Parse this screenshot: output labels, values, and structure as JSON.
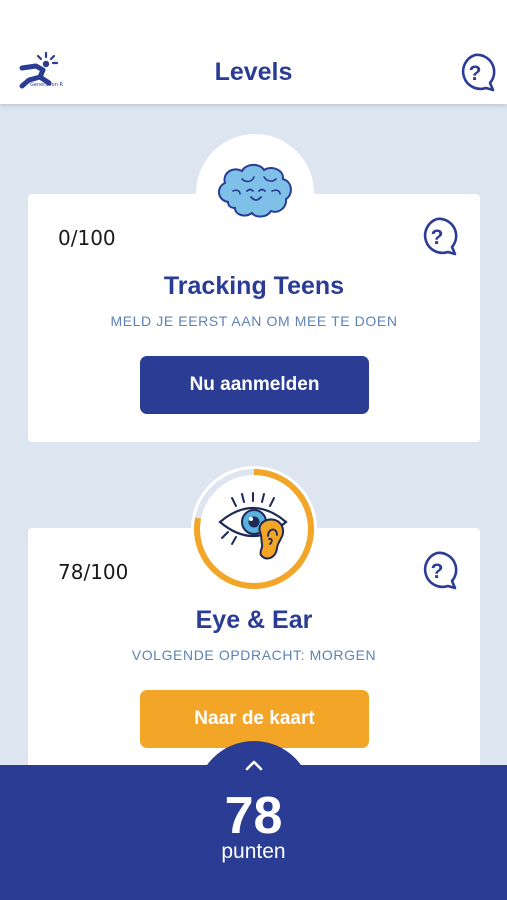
{
  "colors": {
    "brand_blue": "#2a3c93",
    "accent_orange": "#f3a528",
    "subtitle_blue": "#5b83b8",
    "background": "#dde5f1"
  },
  "header": {
    "title": "Levels",
    "logo_caption": "Generation R",
    "logo_icon": "generation-r-logo",
    "help_icon": "help-question-bubble-icon"
  },
  "levels": [
    {
      "score": "0/100",
      "title": "Tracking Teens",
      "subtitle": "MELD JE EERST AAN OM MEE TE DOEN",
      "button_label": "Nu aanmelden",
      "icon": "brain-icon",
      "progress": 0.0
    },
    {
      "score": "78/100",
      "title": "Eye & Ear",
      "subtitle": "VOLGENDE OPDRACHT: MORGEN",
      "button_label": "Naar de kaart",
      "icon": "eye-ear-icon",
      "progress": 0.78
    }
  ],
  "points": {
    "value": "78",
    "label": "punten",
    "expand_icon": "chevron-up-icon"
  }
}
